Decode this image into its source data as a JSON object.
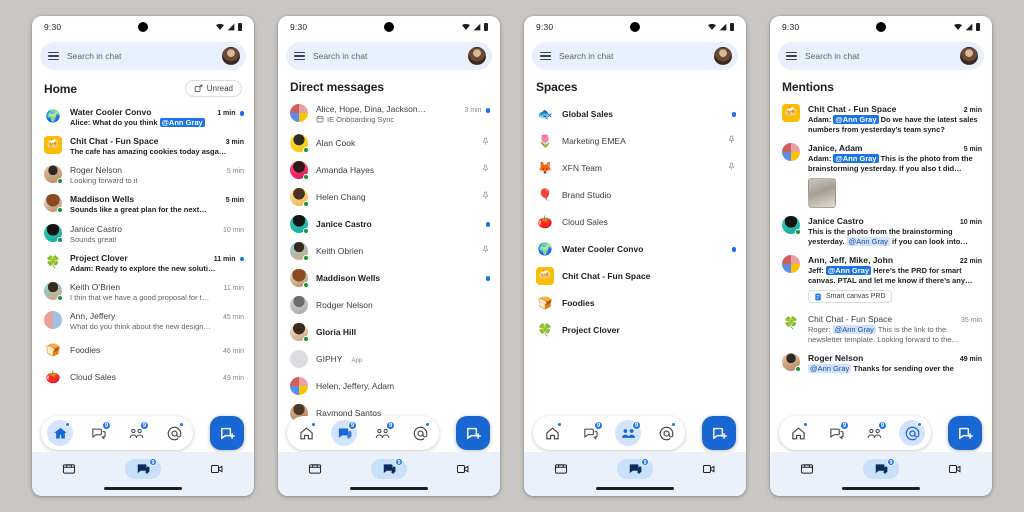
{
  "background_color": "#c9c6c4",
  "accent_color": "#1a73e8",
  "status_bar": {
    "time": "9:30",
    "wifi_icon": "wifi-icon",
    "signal_icon": "signal-icon",
    "battery_icon": "battery-icon"
  },
  "search": {
    "placeholder": "Search in chat",
    "menu_icon": "hamburger-menu-icon",
    "avatar_icon": "account-avatar"
  },
  "system_nav": {
    "mail_label": "mail-icon",
    "chat_label": "chat-icon",
    "chat_badge": "9",
    "meet_label": "meet-icon"
  },
  "nav_pill": {
    "items": [
      {
        "name": "home",
        "icon": "home-icon",
        "badge": "",
        "badge_dot": true
      },
      {
        "name": "chat",
        "icon": "chat-bubble-icon",
        "badge": "9",
        "badge_dot": false
      },
      {
        "name": "spaces",
        "icon": "spaces-people-icon",
        "badge": "9",
        "badge_dot": false
      },
      {
        "name": "mentions",
        "icon": "at-mention-icon",
        "badge": "",
        "badge_dot": true
      }
    ],
    "fab_icon": "compose-new-icon"
  },
  "screens": [
    {
      "id": "home",
      "title": "Home",
      "active_nav": "home",
      "action": {
        "label": "Unread",
        "icon": "unread-filter-icon"
      },
      "rows": [
        {
          "avatar": "globe-emoji",
          "avatar_kind": "emoji",
          "emoji": "🌍",
          "name": "Water Cooler Convo",
          "unread": true,
          "time": "1 min",
          "dot": true,
          "snippet_pre": "Alice: What do you think ",
          "mention": "@Ann Gray",
          "mention_read": false,
          "snippet_post": ""
        },
        {
          "avatar": "chit-chat-tile",
          "avatar_kind": "tile",
          "emoji": "🍻",
          "tile_color": "#fbbc04",
          "name": "Chit Chat - Fun Space",
          "unread": true,
          "time": "3 min",
          "dot": false,
          "snippet_pre": "The cafe has amazing cookies today asga…"
        },
        {
          "avatar": "roger-nelson-avatar",
          "avatar_kind": "photo",
          "photo": "male1",
          "presence": true,
          "name": "Roger Nelson",
          "unread": false,
          "time": "5 min",
          "dot": false,
          "snippet_pre": "Looking forward to it"
        },
        {
          "avatar": "maddison-wells-avatar",
          "avatar_kind": "photo",
          "photo": "female1",
          "presence": true,
          "name": "Maddison Wells",
          "unread": true,
          "time": "5 min",
          "dot": false,
          "snippet_pre": "Sounds like a great plan for the next…"
        },
        {
          "avatar": "janice-castro-avatar",
          "avatar_kind": "photo",
          "photo": "female2",
          "presence": true,
          "name": "Janice Castro",
          "unread": false,
          "time": "10 min",
          "dot": false,
          "snippet_pre": "Sounds great!"
        },
        {
          "avatar": "clover-emoji",
          "avatar_kind": "emoji",
          "emoji": "🍀",
          "name": "Project Clover",
          "unread": true,
          "time": "11 min",
          "dot": true,
          "snippet_pre": "Adam: Ready to explore the new soluti…"
        },
        {
          "avatar": "keith-obrien-avatar",
          "avatar_kind": "photo",
          "photo": "male2",
          "presence": true,
          "name": "Keith O’Brien",
          "unread": false,
          "time": "11 min",
          "dot": false,
          "snippet_pre": "I thin that we have a good proposal for t…"
        },
        {
          "avatar": "ann-jeffery-avatar",
          "avatar_kind": "photo",
          "photo": "pair1",
          "name": "Ann, Jeffery",
          "unread": false,
          "time": "45 min",
          "dot": false,
          "snippet_pre": "What do you think about the new design…"
        },
        {
          "avatar": "foodies-emoji",
          "avatar_kind": "emoji",
          "emoji": "🍞",
          "name": "Foodies",
          "unread": false,
          "time": "46 min",
          "dot": false,
          "snippet_pre": ""
        },
        {
          "avatar": "cloud-sales-emoji",
          "avatar_kind": "emoji",
          "emoji": "🍅",
          "name": "Cloud Sales",
          "unread": false,
          "time": "49 min",
          "dot": false,
          "snippet_pre": ""
        }
      ]
    },
    {
      "id": "dm",
      "title": "Direct messages",
      "active_nav": "chat",
      "rows": [
        {
          "avatar": "group-avatar",
          "avatar_kind": "group",
          "name": "Alice, Hope, Dina, Jackson…",
          "unread": false,
          "time": "3 min",
          "dot": true,
          "snippet_pre": "IE Onboarding Sync",
          "calendar": true
        },
        {
          "avatar": "alan-cook-avatar",
          "avatar_kind": "photo",
          "photo": "yellow1",
          "presence": true,
          "name": "Alan Cook",
          "unread": false,
          "pin": true
        },
        {
          "avatar": "amanda-hayes-avatar",
          "avatar_kind": "photo",
          "photo": "pink1",
          "presence": true,
          "name": "Amanda Hayes",
          "unread": false,
          "pin": true
        },
        {
          "avatar": "helen-chang-avatar",
          "avatar_kind": "photo",
          "photo": "yellow2",
          "presence": true,
          "name": "Helen Chang",
          "unread": false,
          "pin": true
        },
        {
          "avatar": "janice-castro-avatar",
          "avatar_kind": "photo",
          "photo": "female2",
          "presence": true,
          "name": "Janice Castro",
          "unread": true,
          "dot": true
        },
        {
          "avatar": "keith-obrien-avatar",
          "avatar_kind": "photo",
          "photo": "male2",
          "presence": true,
          "name": "Keith Obrien",
          "unread": false,
          "pin": true
        },
        {
          "avatar": "maddison-wells-avatar",
          "avatar_kind": "photo",
          "photo": "female1",
          "presence": true,
          "name": "Maddison Wells",
          "unread": true,
          "dot": true
        },
        {
          "avatar": "rodger-nelson-avatar",
          "avatar_kind": "photo",
          "photo": "gray1",
          "name": "Rodger Nelson",
          "unread": false
        },
        {
          "avatar": "gloria-hill-avatar",
          "avatar_kind": "photo",
          "photo": "female3",
          "presence": true,
          "name": "Gloria Hill",
          "unread": true
        },
        {
          "avatar": "giphy-avatar",
          "avatar_kind": "photo",
          "photo": "black1",
          "name": "GIPHY",
          "app_label": "App",
          "unread": false
        },
        {
          "avatar": "helen-jeffery-adam-avatar",
          "avatar_kind": "group",
          "name": "Helen, Jeffery, Adam",
          "unread": false
        },
        {
          "avatar": "raymond-santos-avatar",
          "avatar_kind": "photo",
          "photo": "tan1",
          "name": "Raymond Santos",
          "unread": false
        }
      ]
    },
    {
      "id": "spaces",
      "title": "Spaces",
      "active_nav": "spaces",
      "rows": [
        {
          "avatar_kind": "emoji",
          "emoji": "🐟",
          "avatar": "global-sales-icon",
          "name": "Global Sales",
          "unread": true,
          "dot": true
        },
        {
          "avatar_kind": "emoji",
          "emoji": "🌷",
          "avatar": "marketing-emea-icon",
          "name": "Marketing EMEA",
          "unread": false,
          "pin": true
        },
        {
          "avatar_kind": "emoji",
          "emoji": "🦊",
          "avatar": "xfn-team-icon",
          "name": "XFN Team",
          "unread": false,
          "pin": true
        },
        {
          "avatar_kind": "emoji",
          "emoji": "🎈",
          "avatar": "brand-studio-icon",
          "name": "Brand Studio",
          "unread": false
        },
        {
          "avatar_kind": "emoji",
          "emoji": "🍅",
          "avatar": "cloud-sales-icon",
          "name": "Cloud Sales",
          "unread": false
        },
        {
          "avatar_kind": "emoji",
          "emoji": "🌍",
          "avatar": "water-cooler-convo-icon",
          "name": "Water Cooler Convo",
          "unread": true,
          "dot": true
        },
        {
          "avatar_kind": "tile",
          "emoji": "🍻",
          "tile_color": "#fbbc04",
          "avatar": "chit-chat-icon",
          "name": "Chit Chat - Fun Space",
          "unread": true
        },
        {
          "avatar_kind": "emoji",
          "emoji": "🍞",
          "avatar": "foodies-icon",
          "name": "Foodies",
          "unread": true
        },
        {
          "avatar_kind": "emoji",
          "emoji": "🍀",
          "avatar": "project-clover-icon",
          "name": "Project Clover",
          "unread": true
        }
      ]
    },
    {
      "id": "mentions",
      "title": "Mentions",
      "active_nav": "mentions",
      "rows": [
        {
          "avatar_kind": "tile",
          "emoji": "🍻",
          "tile_color": "#fbbc04",
          "avatar": "chit-chat-icon",
          "name": "Chit Chat - Fun Space",
          "unread": true,
          "time": "2 min",
          "snippet_pre": "Adam: ",
          "mention": "@Ann Gray",
          "mention_read": false,
          "snippet_post": " Do we have the latest sales numbers from yesterday’s team sync?"
        },
        {
          "avatar_kind": "group",
          "avatar": "janice-adam-avatar",
          "name": "Janice, Adam",
          "unread": true,
          "time": "5 min",
          "snippet_pre": "Adam: ",
          "mention": "@Ann Gray",
          "mention_read": false,
          "snippet_post": " This is the photo from the brainstorming yesterday. If you also t  did…",
          "photo_attachment": true
        },
        {
          "avatar_kind": "photo",
          "photo": "female2",
          "presence": true,
          "avatar": "janice-castro-avatar",
          "name": "Janice Castro",
          "unread": true,
          "time": "10 min",
          "snippet_pre": "This is the photo from the brainstorming yesterday. ",
          "mention": "@Ann Gray",
          "mention_read": true,
          "snippet_post": " if you can look into…"
        },
        {
          "avatar_kind": "group",
          "avatar": "ann-jeff-mike-john-avatar",
          "name": "Ann, Jeff, Mike, John",
          "unread": true,
          "time": "22 min",
          "snippet_pre": "Jeff: ",
          "mention": "@Ann Gray",
          "mention_read": false,
          "snippet_post": " Here’s the PRD for smart canvas. PTAL and let me know if there’s any…",
          "doc_chip": "Smart canvas PRD"
        },
        {
          "avatar_kind": "emoji",
          "emoji": "🍀",
          "avatar": "chit-chat-clover-icon",
          "name": "Chit Chat - Fun Space",
          "unread": false,
          "time": "35 min",
          "snippet_pre": "Roger: ",
          "mention": "@Ann Gray",
          "mention_read": true,
          "snippet_post": " This is the link to the newsletter template. Looking forward to the…"
        },
        {
          "avatar_kind": "photo",
          "photo": "male1",
          "presence": true,
          "avatar": "roger-nelson-avatar",
          "name": "Roger Nelson",
          "unread": true,
          "time": "49 min",
          "snippet_pre": "",
          "mention": "@Ann Gray",
          "mention_read": true,
          "snippet_post": " Thanks for sending over the"
        }
      ]
    }
  ]
}
